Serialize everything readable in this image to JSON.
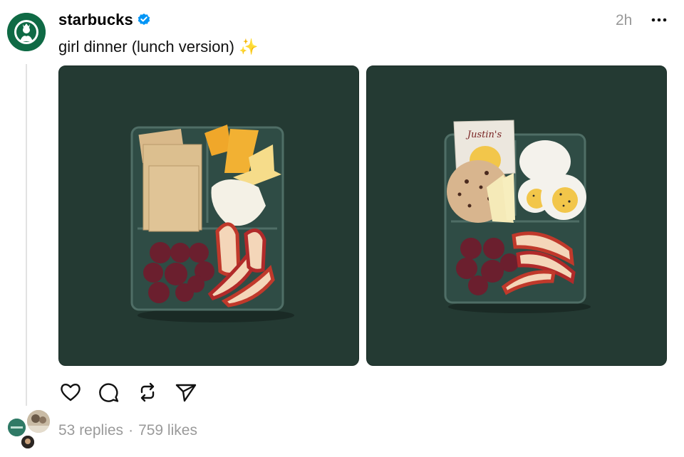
{
  "post": {
    "username": "starbucks",
    "verified": true,
    "timestamp": "2h",
    "caption": "girl dinner (lunch version) ✨",
    "images": [
      {
        "alt": "cheese, crackers, grapes and apple slices snack box",
        "background": "#243a33"
      },
      {
        "alt": "egg, bagel, peanut butter, grapes and apple slices snack box",
        "background": "#243a33"
      }
    ],
    "justins_label": "Justin's"
  },
  "actions": [
    "heart-icon",
    "comment-icon",
    "repost-icon",
    "share-icon"
  ],
  "stats": {
    "replies": "53 replies",
    "separator": "·",
    "likes": "759 likes"
  },
  "colors": {
    "brand_green": "#0f6a45",
    "verified_blue": "#0095f6",
    "muted_text": "#9a9a9a",
    "photo_bg": "#243a33"
  }
}
